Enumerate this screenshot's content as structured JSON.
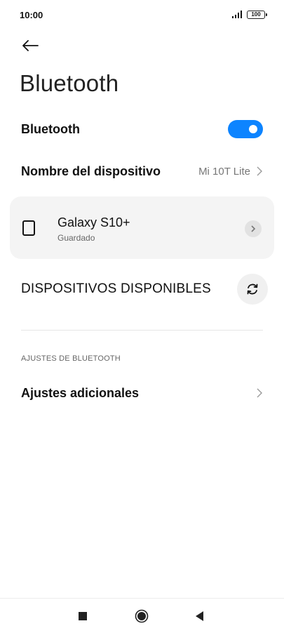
{
  "status_bar": {
    "time": "10:00",
    "battery": "100"
  },
  "page": {
    "title": "Bluetooth"
  },
  "bluetooth_toggle": {
    "label": "Bluetooth",
    "enabled": true,
    "color": "#0d84ff"
  },
  "device_name_row": {
    "label": "Nombre del dispositivo",
    "value": "Mi 10T Lite"
  },
  "paired_devices": [
    {
      "name": "Galaxy S10+",
      "status": "Guardado"
    }
  ],
  "available_devices": {
    "heading": "DISPOSITIVOS DISPONIBLES"
  },
  "settings_section": {
    "heading": "AJUSTES DE BLUETOOTH",
    "items": [
      {
        "label": "Ajustes adicionales"
      }
    ]
  },
  "icons": {
    "back": "back-arrow-icon",
    "refresh": "refresh-icon",
    "device": "phone-device-icon",
    "chevron": "chevron-right-icon"
  }
}
